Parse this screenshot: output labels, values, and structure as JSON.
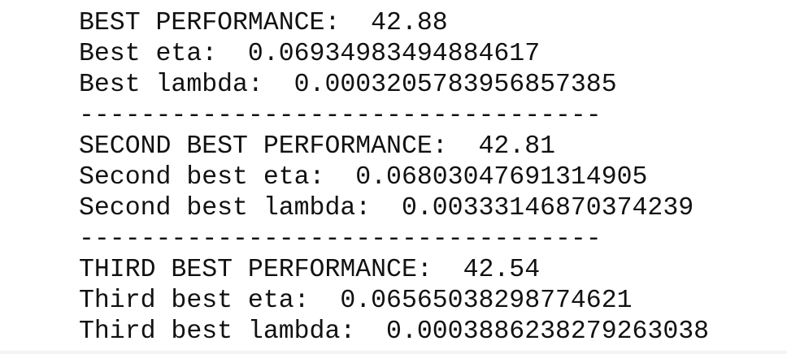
{
  "output": {
    "lines": [
      "BEST PERFORMANCE:  42.88",
      "Best eta:  0.06934983494884617",
      "Best lambda:  0.0003205783956857385",
      "----------------------------------",
      "SECOND BEST PERFORMANCE:  42.81",
      "Second best eta:  0.06803047691314905",
      "Second best lambda:  0.00333146870374239",
      "----------------------------------",
      "THIRD BEST PERFORMANCE:  42.54",
      "Third best eta:  0.06565038298774621",
      "Third best lambda:  0.0003886238279263038"
    ]
  }
}
